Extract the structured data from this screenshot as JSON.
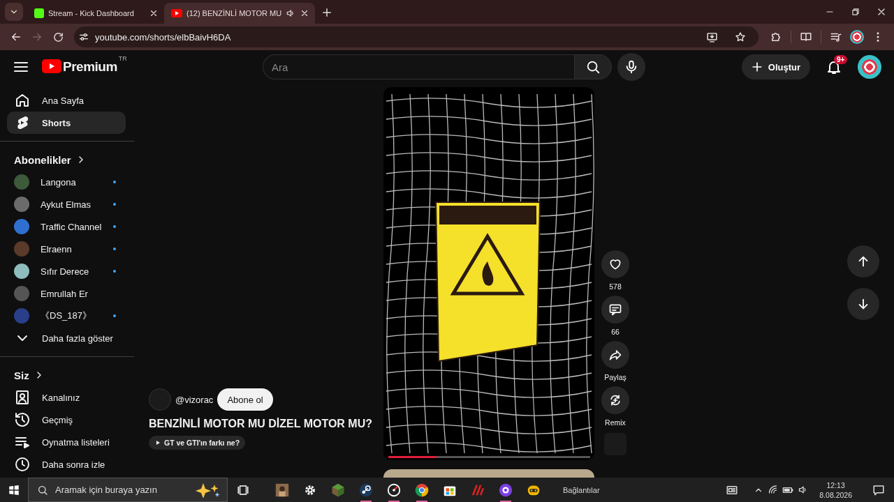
{
  "browser": {
    "tabs": [
      {
        "title": "Stream - Kick Dashboard",
        "selected": false,
        "audio": false
      },
      {
        "title": "(12) BENZİNLİ MOTOR MU",
        "selected": true,
        "audio": true
      }
    ],
    "url": "youtube.com/shorts/elbBaivH6DA"
  },
  "masthead": {
    "logo": "Premium",
    "region": "TR",
    "search_placeholder": "Ara",
    "create_label": "Oluştur",
    "notification_count": "9+"
  },
  "sidebar": {
    "main": [
      {
        "label": "Ana Sayfa",
        "kind": "home",
        "selected": false
      },
      {
        "label": "Shorts",
        "kind": "shorts",
        "selected": true
      }
    ],
    "subscriptions_title": "Abonelikler",
    "subscriptions": [
      {
        "name": "Langona",
        "new_content": true
      },
      {
        "name": "Aykut Elmas",
        "new_content": true
      },
      {
        "name": "Traffic Channel",
        "new_content": true
      },
      {
        "name": "Elraenn",
        "new_content": true
      },
      {
        "name": "Sıfır Derece",
        "new_content": true
      },
      {
        "name": "Emrullah Er",
        "new_content": false
      },
      {
        "name": "《DS_187》",
        "new_content": true
      }
    ],
    "show_more": "Daha fazla göster",
    "you_title": "Siz",
    "you_items": [
      {
        "label": "Kanalınız",
        "kind": "channel"
      },
      {
        "label": "Geçmiş",
        "kind": "history"
      },
      {
        "label": "Oynatma listeleri",
        "kind": "playlists"
      },
      {
        "label": "Daha sonra izle",
        "kind": "watch_later"
      }
    ]
  },
  "short": {
    "channel": "@vizorac",
    "subscribe": "Abone ol",
    "title": "BENZİNLİ MOTOR MU DİZEL MOTOR MU?",
    "related": "GT ve GTI'ın farkı ne?",
    "progress": {
      "level": 0.24
    },
    "actions": [
      {
        "kind": "like",
        "label": "578"
      },
      {
        "kind": "comment",
        "label": "66"
      },
      {
        "kind": "share",
        "label": "Paylaş"
      },
      {
        "kind": "remix",
        "label": "Remix"
      }
    ]
  },
  "taskbar": {
    "search_placeholder": "Aramak için buraya yazın",
    "apps": [
      {
        "kind": "picture",
        "running": false
      },
      {
        "kind": "gear",
        "running": false
      },
      {
        "kind": "cube",
        "running": false
      },
      {
        "kind": "steam",
        "running": true
      },
      {
        "kind": "gauge",
        "running": true
      },
      {
        "kind": "chrome",
        "running": true
      },
      {
        "kind": "store",
        "running": false
      },
      {
        "kind": "stripes",
        "running": false
      },
      {
        "kind": "purple",
        "running": true
      },
      {
        "kind": "robot",
        "running": false
      }
    ],
    "links_label": "Bağlantılar",
    "time": "12:13",
    "date": "8.08.2026"
  }
}
